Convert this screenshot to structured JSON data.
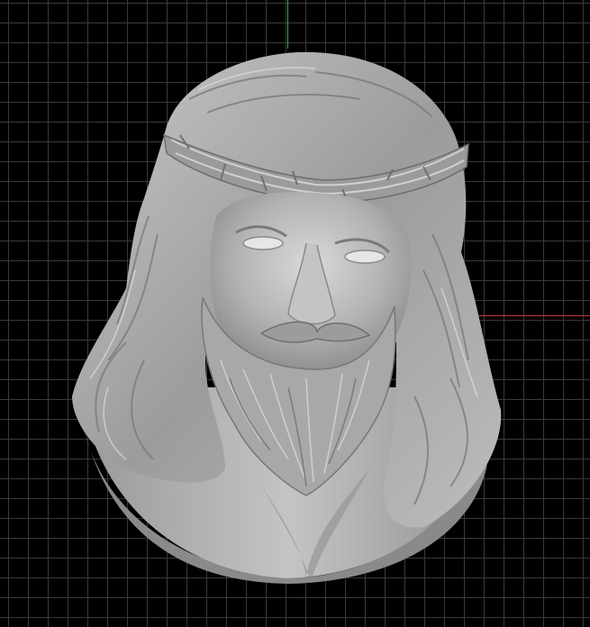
{
  "viewport": {
    "background_color": "#000000",
    "grid_color": "#3a3a3a",
    "grid": true
  },
  "axes": {
    "y_axis_color": "#2bb34a",
    "x_axis_color": "#c23a3a"
  },
  "model": {
    "icon": "relief-sculpture",
    "material_color": "#a9a9a9"
  }
}
